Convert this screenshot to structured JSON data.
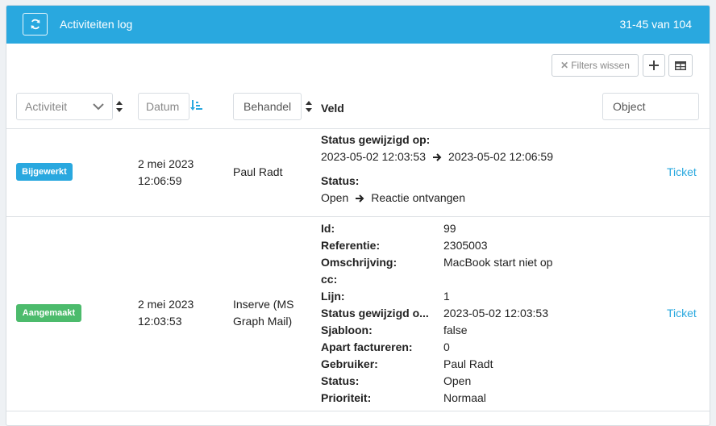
{
  "header": {
    "title": "Activiteiten log",
    "pager": "31-45 van 104"
  },
  "toolbar": {
    "clear_filters_label": "Filters wissen"
  },
  "filters": {
    "activity_placeholder": "Activiteit",
    "date_placeholder": "Datum",
    "handler_placeholder": "Behandel",
    "field_header": "Veld",
    "object_placeholder": "Object"
  },
  "rows": [
    {
      "badge": "Bijgewerkt",
      "badge_color": "#29a8df",
      "date": "2 mei 2023",
      "time": "12:06:59",
      "handler": "Paul Radt",
      "changes": [
        {
          "label": "Status gewijzigd op:",
          "from": "2023-05-02 12:03:53",
          "to": "2023-05-02 12:06:59"
        },
        {
          "label": "Status:",
          "from": "Open",
          "to": "Reactie ontvangen"
        }
      ],
      "object_link": "Ticket"
    },
    {
      "badge": "Aangemaakt",
      "badge_color": "#4cbb6c",
      "date": "2 mei 2023",
      "time": "12:03:53",
      "handler_line1": "Inserve (MS",
      "handler_line2": "Graph Mail)",
      "fields": [
        {
          "key": "Id:",
          "value": "99"
        },
        {
          "key": "Referentie:",
          "value": "2305003"
        },
        {
          "key": "Omschrijving:",
          "value": "MacBook start niet op"
        },
        {
          "key": "cc:",
          "value": ""
        },
        {
          "key": "Lijn:",
          "value": "1"
        },
        {
          "key": "Status gewijzigd o...",
          "value": "2023-05-02 12:03:53"
        },
        {
          "key": "Sjabloon:",
          "value": "false"
        },
        {
          "key": "Apart factureren:",
          "value": "0"
        },
        {
          "key": "Gebruiker:",
          "value": "Paul Radt"
        },
        {
          "key": "Status:",
          "value": "Open"
        },
        {
          "key": "Prioriteit:",
          "value": "Normaal"
        }
      ],
      "object_link": "Ticket"
    }
  ]
}
